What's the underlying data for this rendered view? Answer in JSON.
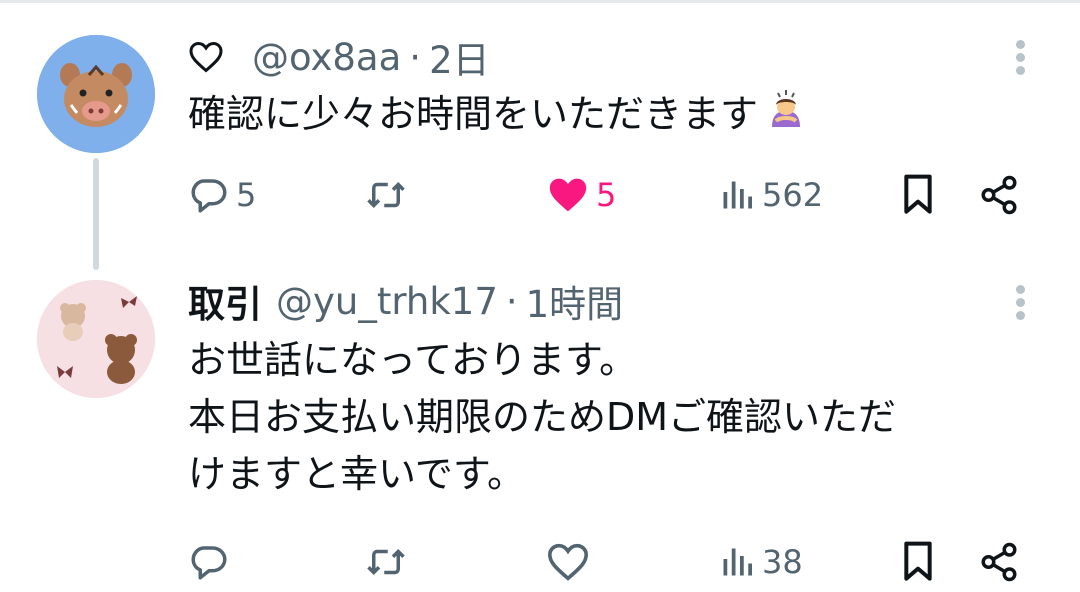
{
  "posts": [
    {
      "name": "",
      "handle": "@ox8aa",
      "separator": "·",
      "time": "2日",
      "lines": [
        "確認に少々お時間をいただきます"
      ],
      "reply_count": "5",
      "retweet_count": "",
      "like_count": "5",
      "view_count": "562",
      "liked": true
    },
    {
      "name": "取引",
      "handle": "@yu_trhk17",
      "separator": "·",
      "time": "1時間",
      "lines": [
        "お世話になっております。",
        "本日お支払い期限のためDMご確認いただ",
        "けますと幸いです。"
      ],
      "reply_count": "",
      "retweet_count": "",
      "like_count": "",
      "view_count": "38",
      "liked": false
    }
  ],
  "icons": {
    "name_prefix_icon": "heart-outline-icon",
    "reply": "speech-bubble-icon",
    "retweet": "retweet-arrows-icon",
    "like": "heart-icon",
    "views": "bar-chart-icon",
    "bookmark": "bookmark-icon",
    "share": "share-icon",
    "more": "more-vertical-icon",
    "emoji": "person-bowing-emoji"
  },
  "colors": {
    "like_active": "#f91880",
    "text_secondary": "#536471",
    "text_primary": "#0f1419",
    "thread_line": "#cfd9de",
    "avatar1_bg": "#7fb0ec"
  }
}
